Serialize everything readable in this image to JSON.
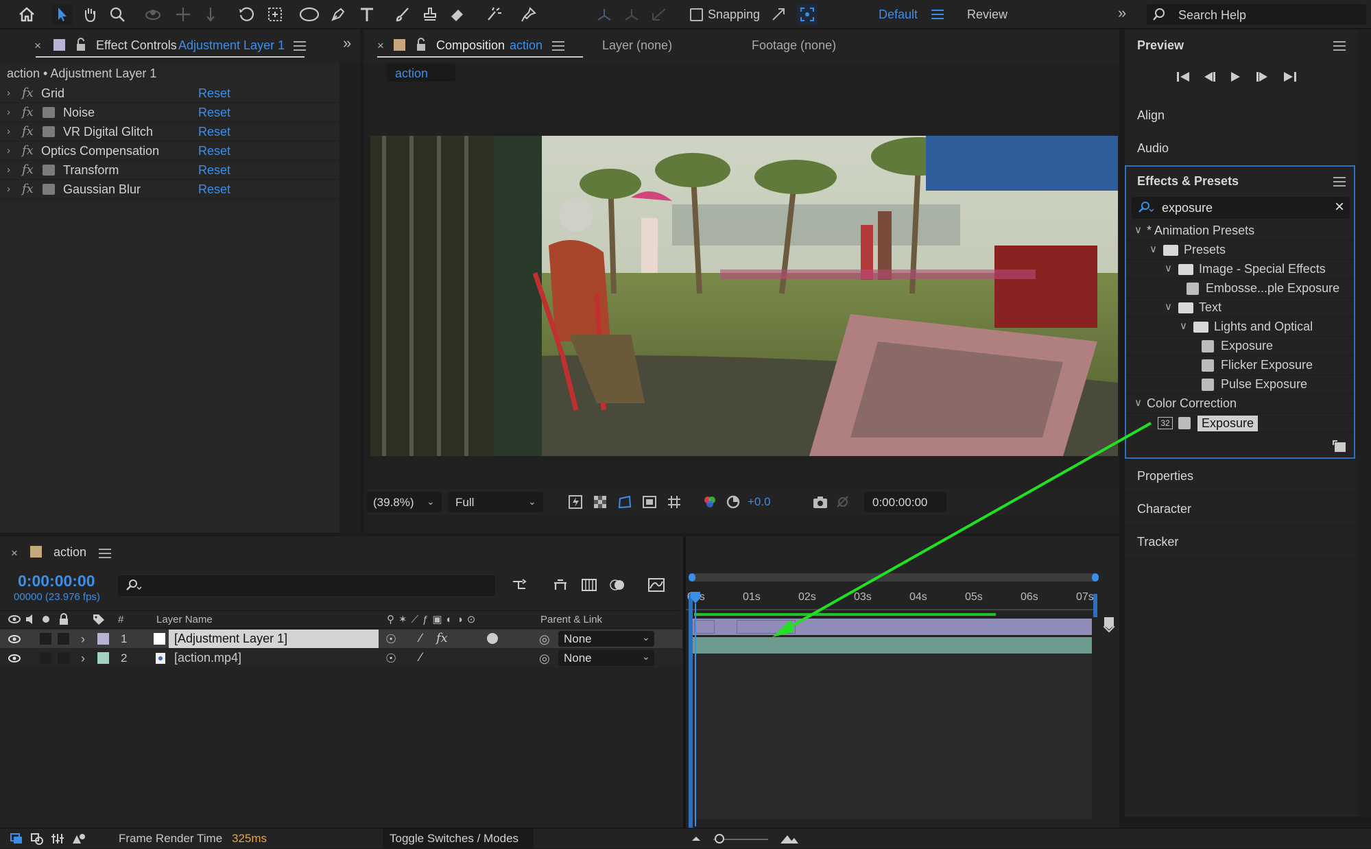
{
  "toolbar": {
    "snapping_label": "Snapping",
    "workspace_active": "Default",
    "workspace_review": "Review",
    "search_placeholder": "Search Help"
  },
  "effect_controls": {
    "tab_title": "Effect Controls",
    "tab_layer": "Adjustment Layer 1",
    "breadcrumb": "action • Adjustment Layer 1",
    "effects": [
      {
        "name": "Grid",
        "reset": "Reset",
        "has_badge": false
      },
      {
        "name": "Noise",
        "reset": "Reset",
        "has_badge": true
      },
      {
        "name": "VR Digital Glitch",
        "reset": "Reset",
        "has_badge": true
      },
      {
        "name": "Optics Compensation",
        "reset": "Reset",
        "has_badge": false
      },
      {
        "name": "Transform",
        "reset": "Reset",
        "has_badge": true
      },
      {
        "name": "Gaussian Blur",
        "reset": "Reset",
        "has_badge": true
      }
    ]
  },
  "composition": {
    "tab_title": "Composition",
    "tab_comp": "action",
    "layer_tab": "Layer (none)",
    "footage_tab": "Footage (none)",
    "subtab": "action",
    "zoom": "(39.8%)",
    "resolution": "Full",
    "exposure_value": "+0.0",
    "timecode": "0:00:00:00"
  },
  "right_panels": {
    "preview": "Preview",
    "align": "Align",
    "audio": "Audio",
    "effects_presets": "Effects & Presets",
    "search_value": "exposure",
    "tree": [
      {
        "label": "* Animation Presets",
        "type": "category"
      },
      {
        "label": "Presets",
        "type": "folder"
      },
      {
        "label": "Image - Special Effects",
        "type": "folder"
      },
      {
        "label": "Embosse...ple Exposure",
        "type": "preset"
      },
      {
        "label": "Text",
        "type": "folder"
      },
      {
        "label": "Lights and Optical",
        "type": "folder"
      },
      {
        "label": "Exposure",
        "type": "preset"
      },
      {
        "label": "Flicker Exposure",
        "type": "preset"
      },
      {
        "label": "Pulse Exposure",
        "type": "preset"
      },
      {
        "label": "Color Correction",
        "type": "category"
      },
      {
        "label": "Exposure",
        "type": "effect",
        "selected": true,
        "bit_badge": "32"
      }
    ],
    "properties": "Properties",
    "character": "Character",
    "tracker": "Tracker"
  },
  "timeline": {
    "tab": "action",
    "timecode": "0:00:00:00",
    "frame_info": "00000 (23.976 fps)",
    "col_number": "#",
    "col_layer_name": "Layer Name",
    "col_parent": "Parent & Link",
    "layers": [
      {
        "index": "1",
        "name": "[Adjustment Layer 1]",
        "parent": "None",
        "label_color": "#b7b2d6",
        "selected": true
      },
      {
        "index": "2",
        "name": "[action.mp4]",
        "parent": "None",
        "label_color": "#a6cfc6",
        "selected": false
      }
    ],
    "ruler_ticks": [
      "00s",
      "01s",
      "02s",
      "03s",
      "04s",
      "05s",
      "06s",
      "07s"
    ]
  },
  "status_bar": {
    "frame_render_label": "Frame Render Time",
    "frame_render_value": "325ms",
    "toggle_label": "Toggle Switches / Modes"
  },
  "colors": {
    "accent_blue": "#3b8eea",
    "arrow_green": "#22e022",
    "adjustment_bar": "#8f8cb8",
    "footage_bar": "#6e9b90"
  }
}
